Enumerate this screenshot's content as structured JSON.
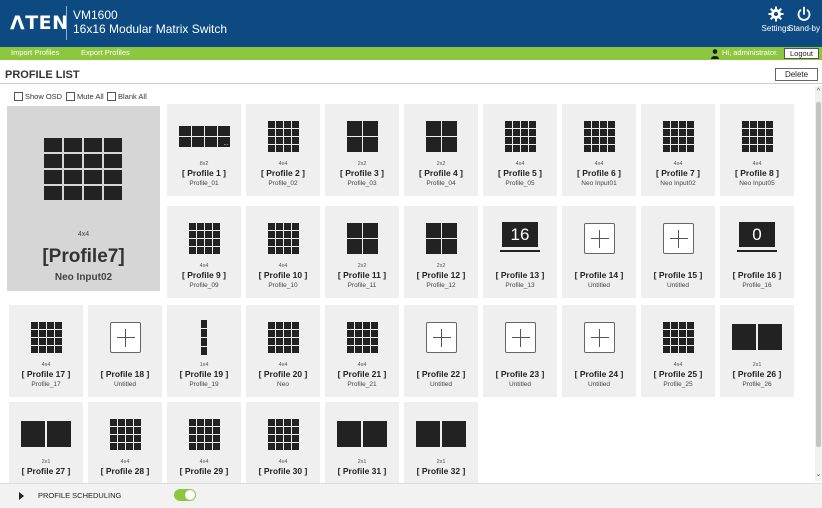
{
  "header": {
    "logo": "ΛTEN",
    "model": "VM1600",
    "product_name": "16x16 Modular Matrix Switch",
    "settings_label": "Settings",
    "standby_label": "Stand-by"
  },
  "subnav": {
    "import_label": "Import Profiles",
    "export_label": "Export Profiles",
    "user_greeting": "Hi, administrator.",
    "logout_label": "Logout"
  },
  "page": {
    "title": "PROFILE LIST",
    "delete_label": "Delete",
    "show_osd": "Show OSD",
    "mute_all": "Mute All",
    "blank_all": "Blank All"
  },
  "preview": {
    "layout": "4x4",
    "name": "[Profile7]",
    "source": "Neo Input02"
  },
  "profiles": [
    {
      "label": "[ Profile 1 ]",
      "layout": "8x2",
      "sub": "Profile_01",
      "icon": "grid-8x2"
    },
    {
      "label": "[ Profile 2 ]",
      "layout": "4x4",
      "sub": "Profile_02",
      "icon": "grid-4x4"
    },
    {
      "label": "[ Profile 3 ]",
      "layout": "2x2",
      "sub": "Profile_03",
      "icon": "grid-2x2"
    },
    {
      "label": "[ Profile 4 ]",
      "layout": "2x2",
      "sub": "Profile_04",
      "icon": "grid-2x2"
    },
    {
      "label": "[ Profile 5 ]",
      "layout": "4x4",
      "sub": "Profile_05",
      "icon": "grid-4x4"
    },
    {
      "label": "[ Profile 6 ]",
      "layout": "4x4",
      "sub": "Neo Input01",
      "icon": "grid-4x4"
    },
    {
      "label": "[ Profile 7 ]",
      "layout": "4x4",
      "sub": "Neo Input02",
      "icon": "grid-4x4"
    },
    {
      "label": "[ Profile 8 ]",
      "layout": "4x4",
      "sub": "Neo Input05",
      "icon": "grid-4x4"
    },
    {
      "label": "[ Profile 9 ]",
      "layout": "4x4",
      "sub": "Profile_09",
      "icon": "grid-4x4"
    },
    {
      "label": "[ Profile 10 ]",
      "layout": "4x4",
      "sub": "Profile_10",
      "icon": "grid-4x4"
    },
    {
      "label": "[ Profile 11 ]",
      "layout": "2x2",
      "sub": "Profile_11",
      "icon": "grid-2x2"
    },
    {
      "label": "[ Profile 12 ]",
      "layout": "2x2",
      "sub": "Profile_12",
      "icon": "grid-2x2"
    },
    {
      "label": "[ Profile 13 ]",
      "layout": "",
      "sub": "Profile_13",
      "icon": "monitor-icon",
      "monitor": "16"
    },
    {
      "label": "[ Profile 14 ]",
      "layout": "",
      "sub": "Untitled",
      "icon": "add-icon"
    },
    {
      "label": "[ Profile 15 ]",
      "layout": "",
      "sub": "Untitled",
      "icon": "add-icon"
    },
    {
      "label": "[ Profile 16 ]",
      "layout": "",
      "sub": "Profile_16",
      "icon": "monitor-icon",
      "monitor": "0"
    },
    {
      "label": "[ Profile 17 ]",
      "layout": "4x4",
      "sub": "Profile_17",
      "icon": "grid-4x4"
    },
    {
      "label": "[ Profile 18 ]",
      "layout": "",
      "sub": "Untitled",
      "icon": "add-icon"
    },
    {
      "label": "[ Profile 19 ]",
      "layout": "1x4",
      "sub": "Profile_19",
      "icon": "grid-1x4"
    },
    {
      "label": "[ Profile 20 ]",
      "layout": "4x4",
      "sub": "Neo",
      "icon": "grid-4x4"
    },
    {
      "label": "[ Profile 21 ]",
      "layout": "4x4",
      "sub": "Profile_21",
      "icon": "grid-4x4"
    },
    {
      "label": "[ Profile 22 ]",
      "layout": "",
      "sub": "Untitled",
      "icon": "add-icon"
    },
    {
      "label": "[ Profile 23 ]",
      "layout": "",
      "sub": "Untitled",
      "icon": "add-icon"
    },
    {
      "label": "[ Profile 24 ]",
      "layout": "",
      "sub": "Untitled",
      "icon": "add-icon"
    },
    {
      "label": "[ Profile 25 ]",
      "layout": "4x4",
      "sub": "Profile_25",
      "icon": "grid-4x4"
    },
    {
      "label": "[ Profile 26 ]",
      "layout": "2x1",
      "sub": "Profile_26",
      "icon": "grid-2x1"
    },
    {
      "label": "[ Profile 27 ]",
      "layout": "2x1",
      "sub": "",
      "icon": "grid-2x1"
    },
    {
      "label": "[ Profile 28 ]",
      "layout": "4x4",
      "sub": "",
      "icon": "grid-4x4"
    },
    {
      "label": "[ Profile 29 ]",
      "layout": "4x4",
      "sub": "",
      "icon": "grid-4x4"
    },
    {
      "label": "[ Profile 30 ]",
      "layout": "4x4",
      "sub": "",
      "icon": "grid-4x4"
    },
    {
      "label": "[ Profile 31 ]",
      "layout": "2x1",
      "sub": "",
      "icon": "grid-2x1"
    },
    {
      "label": "[ Profile 32 ]",
      "layout": "2x1",
      "sub": "",
      "icon": "grid-2x1"
    }
  ],
  "footer": {
    "scheduling_label": "PROFILE SCHEDULING",
    "scheduling_enabled": true
  },
  "colors": {
    "header_bg": "#0e4a82",
    "accent_green": "#8dc63f"
  }
}
